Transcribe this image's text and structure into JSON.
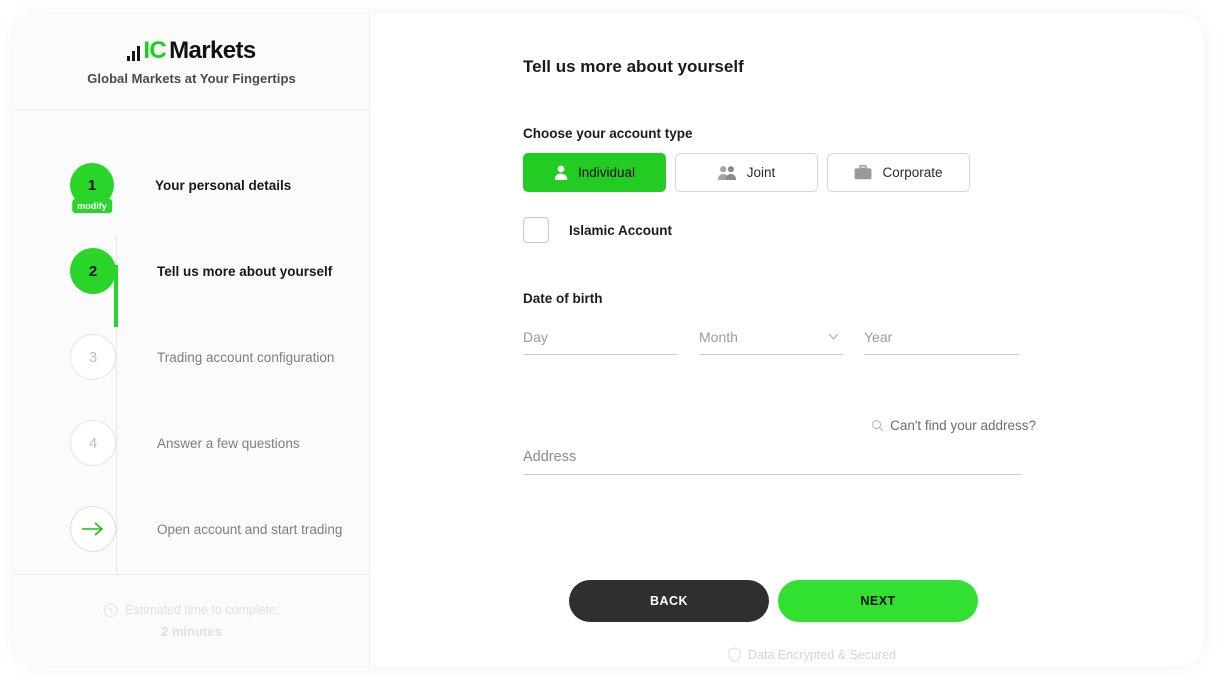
{
  "brand": {
    "logo_icon": "bar-chart-icon",
    "logo_primary": "IC",
    "logo_secondary": "Markets",
    "tagline": "Global Markets at Your Fingertips",
    "accent_green": "#2ad52a"
  },
  "sidebar": {
    "steps": [
      {
        "number": "1",
        "label": "Your personal details",
        "state": "done",
        "badge": "modify"
      },
      {
        "number": "2",
        "label": "Tell us more about yourself",
        "state": "active"
      },
      {
        "number": "3",
        "label": "Trading account configuration",
        "state": "todo"
      },
      {
        "number": "4",
        "label": "Answer a few questions",
        "state": "todo"
      },
      {
        "number": "",
        "label": "Open account and start trading",
        "state": "arrow",
        "icon": "arrow-right-icon"
      }
    ],
    "footer": {
      "clock_icon": "clock-icon",
      "estimate_label": "Estimated time to complete:",
      "estimate_value": "2 minutes"
    }
  },
  "main": {
    "title": "Tell us more about yourself",
    "account_type": {
      "label": "Choose your account type",
      "options": [
        {
          "label": "Individual",
          "icon": "person-icon",
          "selected": true
        },
        {
          "label": "Joint",
          "icon": "two-people-icon",
          "selected": false
        },
        {
          "label": "Corporate",
          "icon": "briefcase-icon",
          "selected": false
        }
      ]
    },
    "islamic_account": {
      "label": "Islamic Account",
      "checked": false
    },
    "date_of_birth": {
      "label": "Date of birth",
      "day": {
        "placeholder": "Day",
        "value": ""
      },
      "month": {
        "placeholder": "Month",
        "value": "",
        "icon": "chevron-down-icon"
      },
      "year": {
        "placeholder": "Year",
        "value": ""
      }
    },
    "address": {
      "cant_find_label": "Can't find your address?",
      "cant_find_icon": "search-icon",
      "placeholder": "Address",
      "value": ""
    },
    "actions": {
      "back_label": "BACK",
      "next_label": "NEXT"
    },
    "secured": {
      "icon": "shield-icon",
      "label": "Data Encrypted & Secured"
    }
  }
}
